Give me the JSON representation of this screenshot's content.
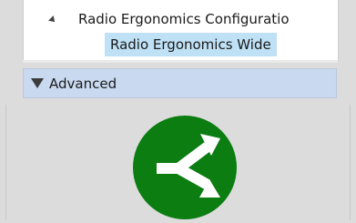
{
  "tree": {
    "parent_label": "Radio Ergonomics Configuratio",
    "child_label": "Radio Ergonomics Wide"
  },
  "advanced": {
    "label": "Advanced"
  },
  "icons": {
    "tree_expander": "triangle-down-right-icon",
    "section_collapse": "triangle-down-icon",
    "main_icon": "split-arrow-icon"
  },
  "colors": {
    "main_icon_bg": "#0b7d11",
    "main_icon_fg": "#ffffff",
    "selection": "#bfe1f5",
    "header": "#c8d9f0"
  }
}
